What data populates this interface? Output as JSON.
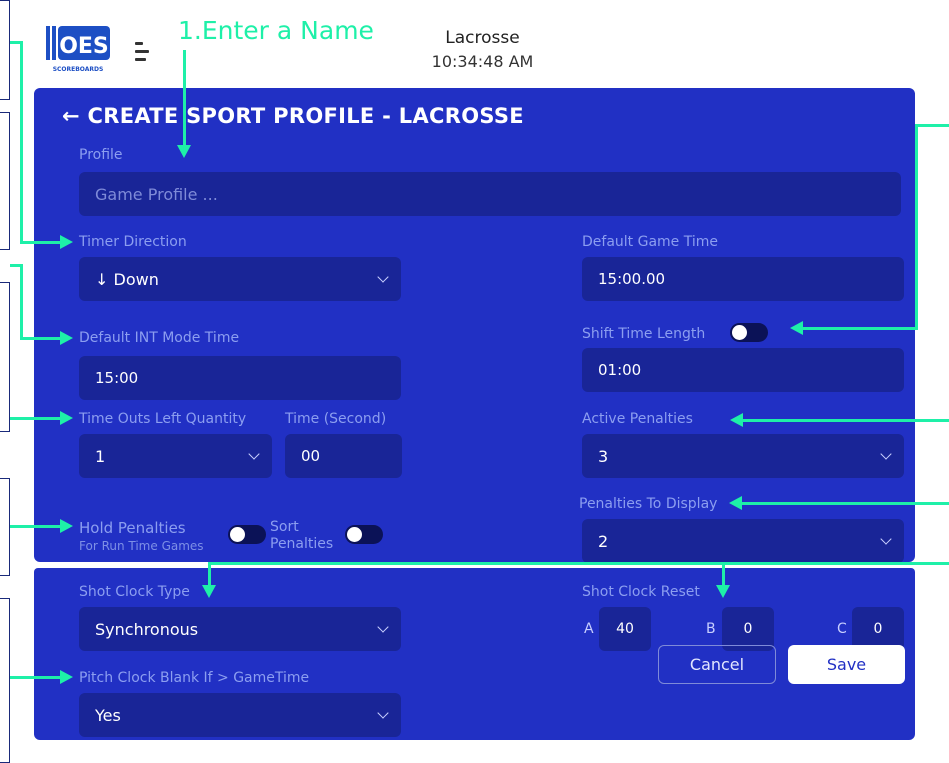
{
  "header": {
    "logo_text": "OES",
    "logo_sub": "SCOREBOARDS",
    "sport": "Lacrosse",
    "time": "10:34:48 AM"
  },
  "annotation": {
    "step1": "1.Enter a Name"
  },
  "form": {
    "title": "← CREATE SPORT PROFILE - LACROSSE",
    "profile": {
      "label": "Profile",
      "placeholder": "Game Profile ..."
    },
    "timer_direction": {
      "label": "Timer Direction",
      "value": "↓ Down"
    },
    "default_game_time": {
      "label": "Default Game Time",
      "value": "15:00.00"
    },
    "default_int_mode_time": {
      "label": "Default INT Mode Time",
      "value": "15:00"
    },
    "shift_time": {
      "label": "Shift Time Length",
      "value": "01:00"
    },
    "time_outs": {
      "label": "Time Outs Left Quantity",
      "value": "1"
    },
    "time_seconds": {
      "label": "Time (Second)",
      "value": "00"
    },
    "active_penalties": {
      "label": "Active Penalties",
      "value": "3"
    },
    "hold_penalties": {
      "label": "Hold Penalties",
      "sublabel": "For Run Time Games"
    },
    "sort_penalties": {
      "label_line1": "Sort",
      "label_line2": "Penalties"
    },
    "penalties_to_display": {
      "label": "Penalties To Display",
      "value": "2"
    },
    "shot_clock_type": {
      "label": "Shot Clock Type",
      "value": "Synchronous"
    },
    "shot_clock_reset": {
      "label": "Shot Clock Reset",
      "a_label": "A",
      "a_value": "40",
      "b_label": "B",
      "b_value": "0",
      "c_label": "C",
      "c_value": "0"
    },
    "pitch_clock": {
      "label": "Pitch Clock Blank If > GameTime",
      "value": "Yes"
    },
    "cancel_label": "Cancel",
    "save_label": "Save"
  },
  "colors": {
    "panel": "#2130c4",
    "field": "#192597",
    "annotation": "#1ef0a8",
    "label": "#8c9ef0"
  }
}
